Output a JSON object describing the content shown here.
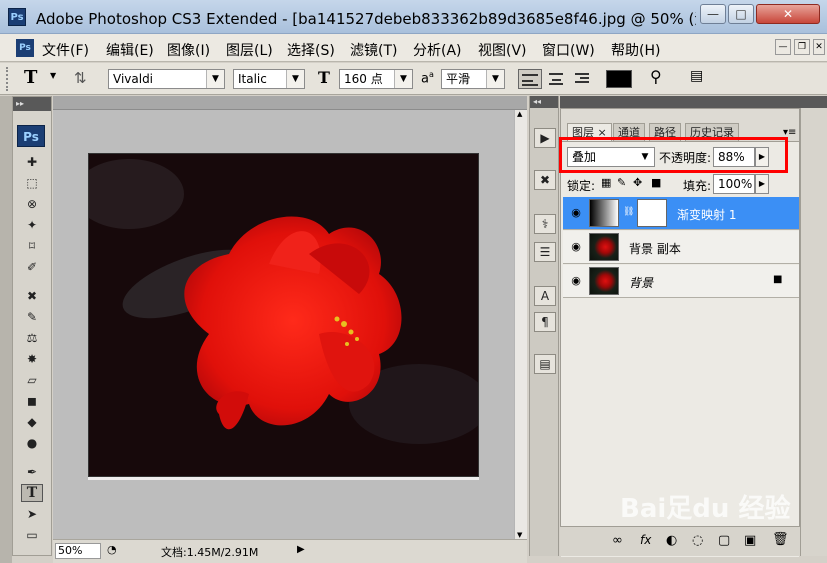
{
  "window": {
    "ps_icon_text": "Ps",
    "title": "Adobe Photoshop CS3 Extended - [ba141527debeb833362b89d3685e8f46.jpg @ 50% (渐...",
    "min_glyph": "—",
    "max_glyph": "□",
    "close_glyph": "✕"
  },
  "menu": {
    "ps_icon_text": "Ps",
    "items": [
      "文件(F)",
      "编辑(E)",
      "图像(I)",
      "图层(L)",
      "选择(S)",
      "滤镜(T)",
      "分析(A)",
      "视图(V)",
      "窗口(W)",
      "帮助(H)"
    ],
    "doc_min": "—",
    "doc_restore": "❐",
    "doc_close": "✕"
  },
  "options": {
    "tool_glyph": "T",
    "font_family": "Vivaldi",
    "font_style": "Italic",
    "font_size": "160 点",
    "aa_label": "a",
    "antialias": "平滑",
    "color": "#000000"
  },
  "toolbox": {
    "head": "▸▸",
    "logo": "Ps",
    "tools": [
      "✚",
      "⬚",
      "⊗",
      "✦",
      "⌑",
      "✐",
      "✖",
      "✎",
      "⚖",
      "✸",
      "▱",
      "◼",
      "◆",
      "●",
      "✒",
      "T",
      "➤",
      "▭"
    ]
  },
  "document": {
    "zoom": "50%",
    "doc_info": "文档:1.45M/2.91M",
    "arrow": "▶"
  },
  "dock": {
    "head": "◂◂",
    "buttons": [
      "▶",
      "✖",
      "⚕",
      "☰",
      "A",
      "¶",
      "▤"
    ]
  },
  "layers_panel": {
    "tabs": [
      "图层",
      "通道",
      "路径",
      "历史记录"
    ],
    "tab_close": "×",
    "menu_glyph": "▾≡",
    "blend_mode": "叠加",
    "opacity_label": "不透明度:",
    "opacity_value": "88%",
    "lock_label": "锁定:",
    "fill_label": "填充:",
    "fill_value": "100%",
    "layers": [
      {
        "name": "渐变映射 1",
        "selected": true
      },
      {
        "name": "背景 副本",
        "selected": false
      },
      {
        "name": "背景",
        "selected": false
      }
    ],
    "eye_glyph": "◉",
    "lock_glyph": "🔒",
    "bottom_icons": [
      "∞",
      "fx",
      "◐",
      "◌",
      "▢",
      "▣",
      "🗑"
    ]
  },
  "watermark": "Bai足du 经验"
}
